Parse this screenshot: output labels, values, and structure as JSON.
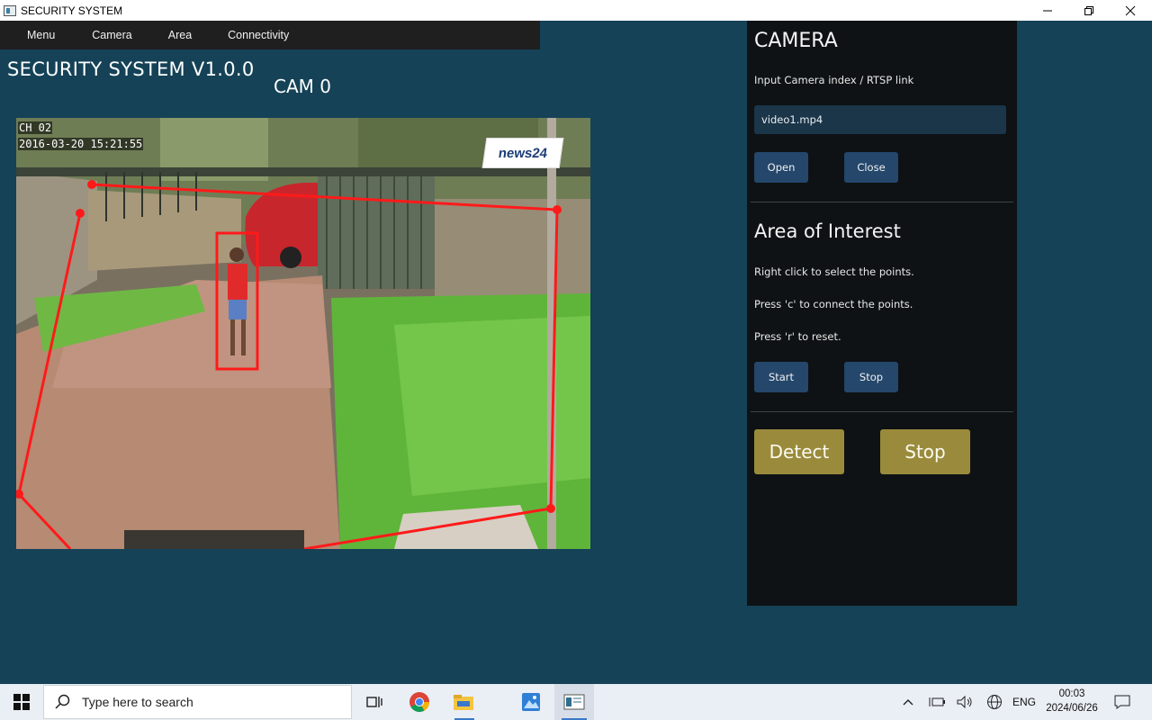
{
  "window": {
    "title": "SECURITY SYSTEM"
  },
  "menu": {
    "items": [
      "Menu",
      "Camera",
      "Area",
      "Connectivity"
    ]
  },
  "main": {
    "app_title": "SECURITY SYSTEM V1.0.0",
    "cam_label": "CAM 0",
    "video": {
      "osd_channel": "CH 02",
      "osd_timestamp": "2016-03-20 15:21:55",
      "watermark": "news24"
    }
  },
  "panel": {
    "camera_heading": "CAMERA",
    "camera_input_label": "Input Camera index / RTSP link",
    "camera_input_value": "video1.mp4",
    "open_label": "Open",
    "close_label": "Close",
    "aoi_heading": "Area of Interest",
    "aoi_instructions": [
      "Right click to select the points.",
      "Press 'c' to connect the points.",
      "Press 'r' to reset."
    ],
    "start_label": "Start",
    "stop_label": "Stop",
    "detect_label": "Detect",
    "detect_stop_label": "Stop"
  },
  "taskbar": {
    "search_placeholder": "Type here to search",
    "language": "ENG",
    "time": "00:03",
    "date": "2024/06/26",
    "icons": [
      "windows-start-icon",
      "search-icon",
      "task-view-icon",
      "chrome-icon",
      "file-explorer-icon",
      "photos-icon",
      "security-app-icon",
      "chevron-up-icon",
      "battery-icon",
      "volume-icon",
      "globe-icon",
      "notification-icon"
    ]
  },
  "colors": {
    "background": "#154257",
    "panel": "#0e1214",
    "button_blue": "#24476b",
    "button_gold": "#9a8b3c",
    "overlay_red": "#ff1a1a"
  }
}
